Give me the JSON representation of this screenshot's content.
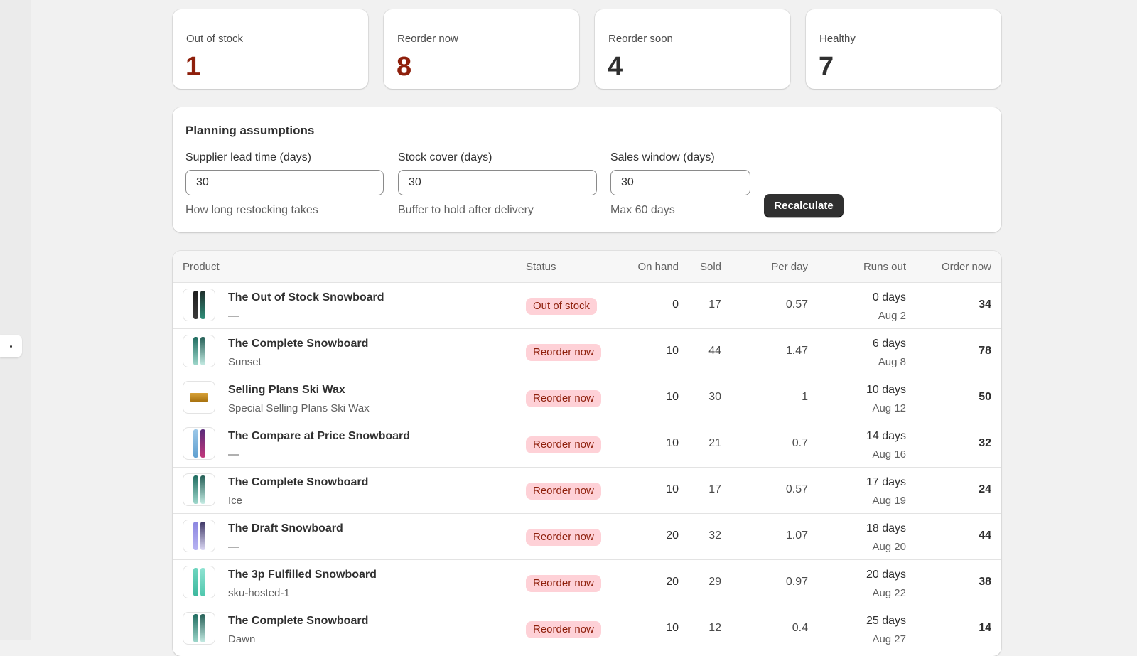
{
  "summary": [
    {
      "label": "Out of stock",
      "value": "1",
      "color": "#8e1f0b"
    },
    {
      "label": "Reorder now",
      "value": "8",
      "color": "#8e1f0b"
    },
    {
      "label": "Reorder soon",
      "value": "4",
      "color": "#303030"
    },
    {
      "label": "Healthy",
      "value": "7",
      "color": "#303030"
    }
  ],
  "planning": {
    "title": "Planning assumptions",
    "lead_time": {
      "label": "Supplier lead time (days)",
      "value": "30",
      "help": "How long restocking takes"
    },
    "stock_cover": {
      "label": "Stock cover (days)",
      "value": "30",
      "help": "Buffer to hold after delivery"
    },
    "sales_window": {
      "label": "Sales window (days)",
      "value": "30",
      "help": "Max 60 days"
    },
    "recalculate_label": "Recalculate"
  },
  "table": {
    "headers": {
      "product": "Product",
      "status": "Status",
      "on_hand": "On hand",
      "sold": "Sold",
      "per_day": "Per day",
      "runs_out": "Runs out",
      "order_now": "Order now"
    },
    "rows": [
      {
        "name": "The Out of Stock Snowboard",
        "variant": "—",
        "status": "Out of stock",
        "on_hand": "0",
        "sold": "17",
        "per_day": "0.57",
        "runs_out_days": "0 days",
        "runs_out_date": "Aug 2",
        "order_now": "34",
        "thumb": "snowboard-dark"
      },
      {
        "name": "The Complete Snowboard",
        "variant": "Sunset",
        "status": "Reorder now",
        "on_hand": "10",
        "sold": "44",
        "per_day": "1.47",
        "runs_out_days": "6 days",
        "runs_out_date": "Aug 8",
        "order_now": "78",
        "thumb": "snowboard-teal"
      },
      {
        "name": "Selling Plans Ski Wax",
        "variant": "Special Selling Plans Ski Wax",
        "status": "Reorder now",
        "on_hand": "10",
        "sold": "30",
        "per_day": "1",
        "runs_out_days": "10 days",
        "runs_out_date": "Aug 12",
        "order_now": "50",
        "thumb": "ski-wax"
      },
      {
        "name": "The Compare at Price Snowboard",
        "variant": "—",
        "status": "Reorder now",
        "on_hand": "10",
        "sold": "21",
        "per_day": "0.7",
        "runs_out_days": "14 days",
        "runs_out_date": "Aug 16",
        "order_now": "32",
        "thumb": "snowboard-blue-purple"
      },
      {
        "name": "The Complete Snowboard",
        "variant": "Ice",
        "status": "Reorder now",
        "on_hand": "10",
        "sold": "17",
        "per_day": "0.57",
        "runs_out_days": "17 days",
        "runs_out_date": "Aug 19",
        "order_now": "24",
        "thumb": "snowboard-teal"
      },
      {
        "name": "The Draft Snowboard",
        "variant": "—",
        "status": "Reorder now",
        "on_hand": "20",
        "sold": "32",
        "per_day": "1.07",
        "runs_out_days": "18 days",
        "runs_out_date": "Aug 20",
        "order_now": "44",
        "thumb": "snowboard-violet"
      },
      {
        "name": "The 3p Fulfilled Snowboard",
        "variant": "sku-hosted-1",
        "status": "Reorder now",
        "on_hand": "20",
        "sold": "29",
        "per_day": "0.97",
        "runs_out_days": "20 days",
        "runs_out_date": "Aug 22",
        "order_now": "38",
        "thumb": "snowboard-mint"
      },
      {
        "name": "The Complete Snowboard",
        "variant": "Dawn",
        "status": "Reorder now",
        "on_hand": "10",
        "sold": "12",
        "per_day": "0.4",
        "runs_out_days": "25 days",
        "runs_out_date": "Aug 27",
        "order_now": "14",
        "thumb": "snowboard-teal"
      }
    ]
  },
  "colors": {
    "critical_text": "#8e1f0b",
    "critical_badge_bg": "#fed1d7",
    "button_bg": "#303030",
    "page_bg": "#f1f1f1"
  }
}
